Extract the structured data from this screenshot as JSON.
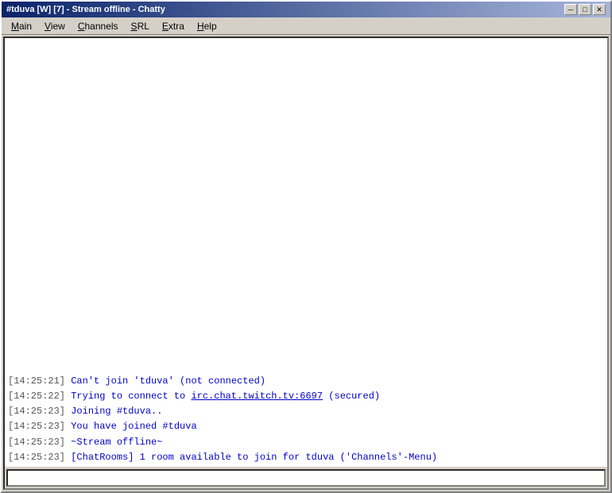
{
  "window": {
    "title": "#tduva [W] [7] - Stream offline - Chatty",
    "app_name": "Chatty"
  },
  "title_bar": {
    "text": "#tduva [W] [7] - Stream offline - Chatty"
  },
  "controls": {
    "minimize": "─",
    "maximize": "□",
    "close": "✕"
  },
  "menu": {
    "items": [
      {
        "label": "Main",
        "underline_index": 0
      },
      {
        "label": "View",
        "underline_index": 0
      },
      {
        "label": "Channels",
        "underline_index": 0
      },
      {
        "label": "SRL",
        "underline_index": 0
      },
      {
        "label": "Extra",
        "underline_index": 0
      },
      {
        "label": "Help",
        "underline_index": 0
      }
    ]
  },
  "messages": [
    {
      "id": 1,
      "timestamp": "[14:25:21]",
      "text": " Can't join 'tduva' (not connected)"
    },
    {
      "id": 2,
      "timestamp": "[14:25:22]",
      "text_before": " Trying to connect to ",
      "link": "irc.chat.twitch.tv:6697",
      "text_after": " (secured)"
    },
    {
      "id": 3,
      "timestamp": "[14:25:23]",
      "text": " Joining #tduva.."
    },
    {
      "id": 4,
      "timestamp": "[14:25:23]",
      "text": " You have joined #tduva"
    },
    {
      "id": 5,
      "timestamp": "[14:25:23]",
      "text": " ~Stream offline~"
    },
    {
      "id": 6,
      "timestamp": "[14:25:23]",
      "text": " [ChatRooms] 1 room available to join for tduva ('Channels'-Menu)"
    }
  ],
  "input": {
    "placeholder": ""
  }
}
